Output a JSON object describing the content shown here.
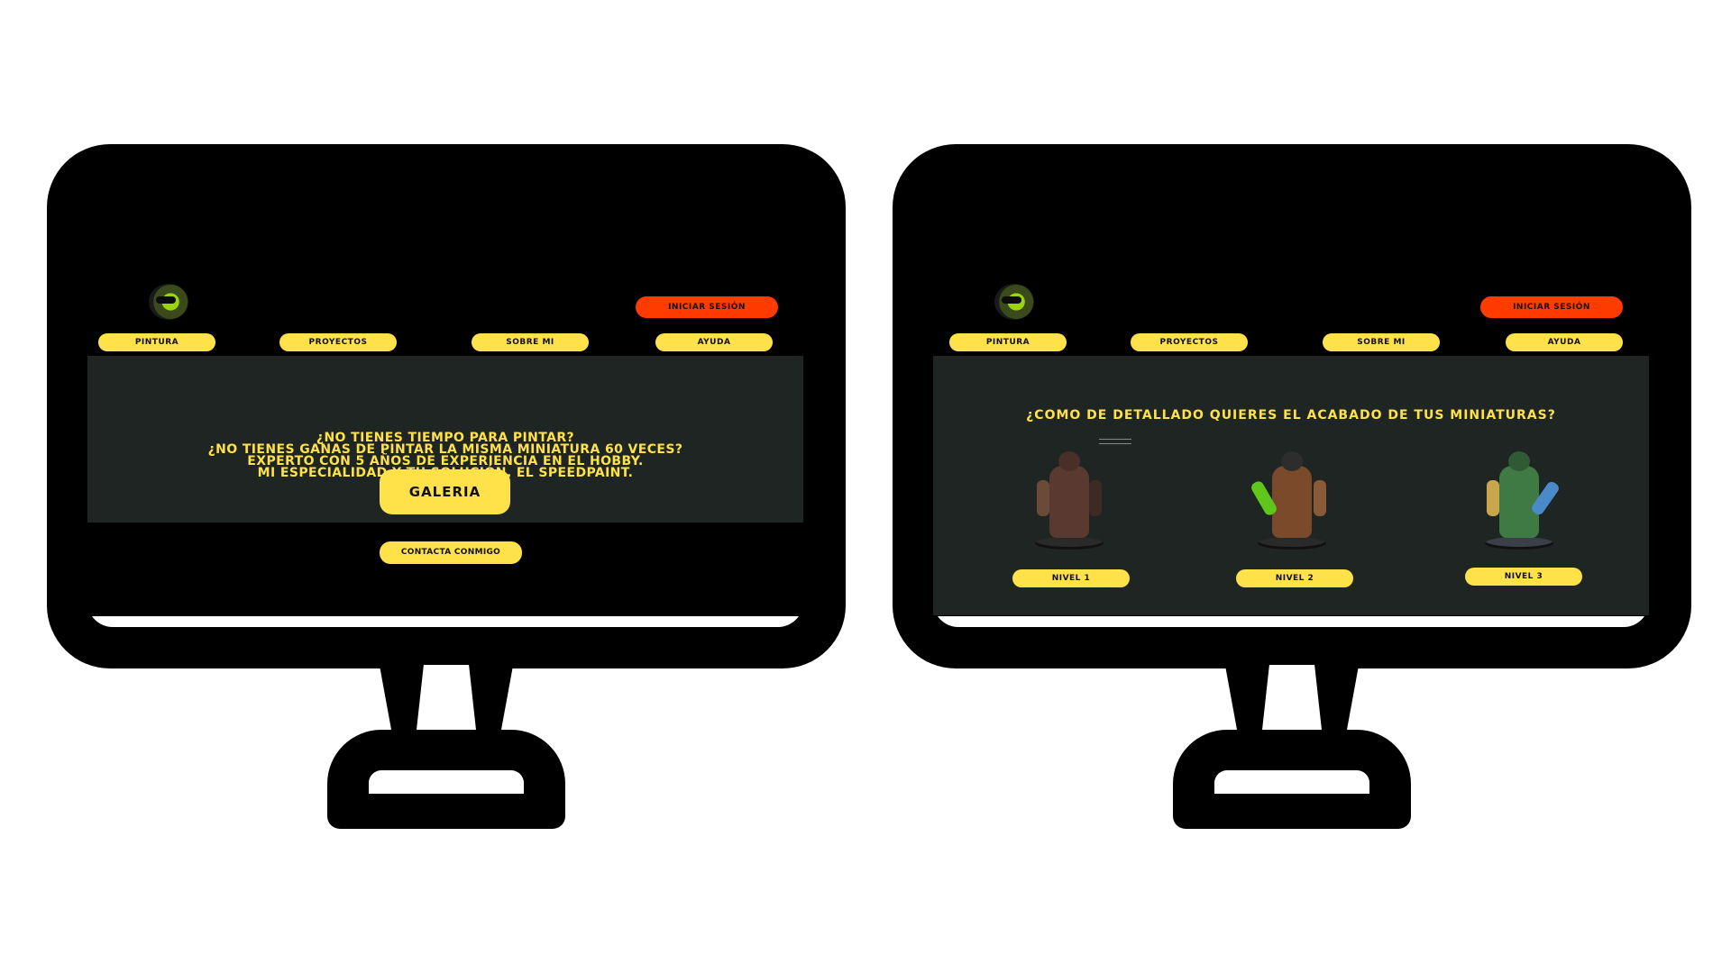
{
  "left_screen": {
    "login_label": "INICIAR SESIÓN",
    "nav": [
      {
        "label": "PINTURA"
      },
      {
        "label": "PROYECTOS"
      },
      {
        "label": "SOBRE MI"
      },
      {
        "label": "AYUDA"
      }
    ],
    "hero_lines": [
      "¿NO TIENES TIEMPO PARA PINTAR?",
      "¿NO TIENES GANAS DE PINTAR LA MISMA MINIATURA 60 VECES?",
      "EXPERTO CON 5 AÑOS DE EXPERIENCIA EN EL HOBBY.",
      "MI ESPECIALIDAD Y TU SOLUCIÓN, EL SPEEDPAINT."
    ],
    "galeria_label": "GALERIA",
    "contact_label": "CONTACTA CONMIGO"
  },
  "right_screen": {
    "login_label": "INICIAR SESIÓN",
    "nav": [
      {
        "label": "PINTURA"
      },
      {
        "label": "PROYECTOS"
      },
      {
        "label": "SOBRE MI"
      },
      {
        "label": "AYUDA"
      }
    ],
    "title": "¿COMO DE DETALLADO QUIERES EL ACABADO DE TUS MINIATURAS?",
    "levels": [
      {
        "label": "NIVEL 1"
      },
      {
        "label": "NIVEL 2"
      },
      {
        "label": "NIVEL 3"
      }
    ]
  },
  "colors": {
    "accent_yellow": "#ffe14a",
    "login_orange": "#ff3b00",
    "panel_dark": "#1f2522"
  }
}
